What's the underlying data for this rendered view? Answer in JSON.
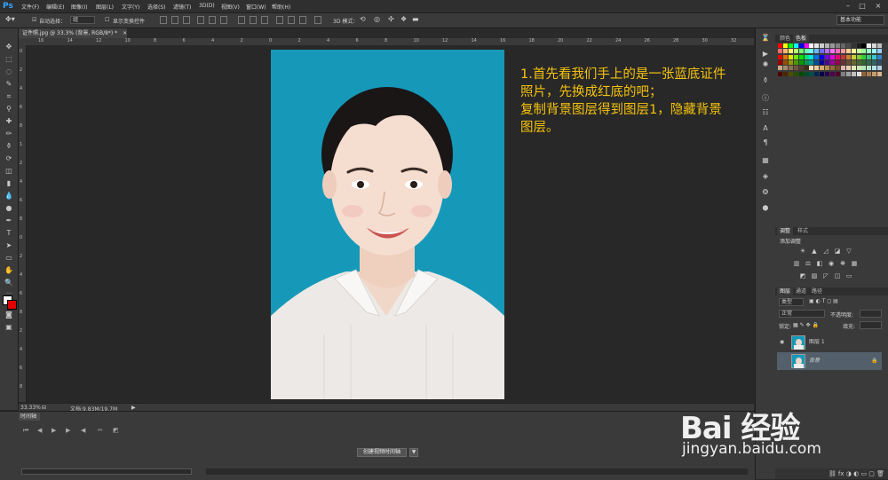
{
  "app": {
    "logo": "Ps"
  },
  "menu": [
    "文件(F)",
    "编辑(E)",
    "图像(I)",
    "图层(L)",
    "文字(Y)",
    "选择(S)",
    "滤镜(T)",
    "3D(D)",
    "视图(V)",
    "窗口(W)",
    "帮助(H)"
  ],
  "window_controls": {
    "minimize": "–",
    "maximize": "□",
    "close": "×"
  },
  "options_bar": {
    "auto_select_label": "自动选择：",
    "auto_select_value": "组",
    "show_transform_label": "显示变换控件",
    "mode_3d_label": "3D 模式：",
    "workspace": "基本功能"
  },
  "document": {
    "tab_title": "证件照.jpg @ 33.3% (背景, RGB/8*) *",
    "close": "×"
  },
  "ruler_top": [
    "16",
    "14",
    "12",
    "10",
    "8",
    "6",
    "4",
    "2",
    "0",
    "2",
    "4",
    "6",
    "8",
    "10",
    "12",
    "14",
    "16",
    "18",
    "20",
    "22",
    "24",
    "26",
    "28",
    "30",
    "32"
  ],
  "ruler_left": [
    "0",
    "2",
    "4",
    "6",
    "8",
    "1",
    "2",
    "4",
    "6",
    "8",
    "0",
    "2",
    "4",
    "6",
    "8",
    "2",
    "4",
    "6",
    "8"
  ],
  "annotation": {
    "lines": [
      "1.首先看我们手上的是一张蓝底证件",
      "照片，先换成红底的吧；",
      "复制背景图层得到图层1，隐藏背景",
      "图层。"
    ],
    "color": "#f4c20d"
  },
  "status": {
    "zoom": "33.33%",
    "doc_size": "文档:9.83M/19.7M",
    "arrow": "▶"
  },
  "timeline": {
    "tab": "时间轴",
    "create_button": "创建视频时间轴",
    "dropdown_arrow": "▼"
  },
  "panels": {
    "swatch_tabs": [
      "颜色",
      "色板"
    ],
    "adjust_tabs": [
      "调整",
      "样式"
    ],
    "adjust_title": "添加调整",
    "layer_tabs": [
      "图层",
      "通道",
      "路径"
    ],
    "kind_filter": "类型",
    "blend_mode": "正常",
    "opacity_label": "不透明度:",
    "lock_label": "锁定:",
    "fill_label": "填充:",
    "layers": [
      {
        "name": "图层 1",
        "visible": true,
        "selected": false
      },
      {
        "name": "背景",
        "visible": false,
        "selected": true
      }
    ]
  },
  "watermark": {
    "brand": "Bai 经验",
    "url": "jingyan.baidu.com"
  },
  "colors": {
    "photo_bg": "#1699b9",
    "panel": "#3a3a3a",
    "canvas": "#282828",
    "accent": "#f4c20d"
  }
}
